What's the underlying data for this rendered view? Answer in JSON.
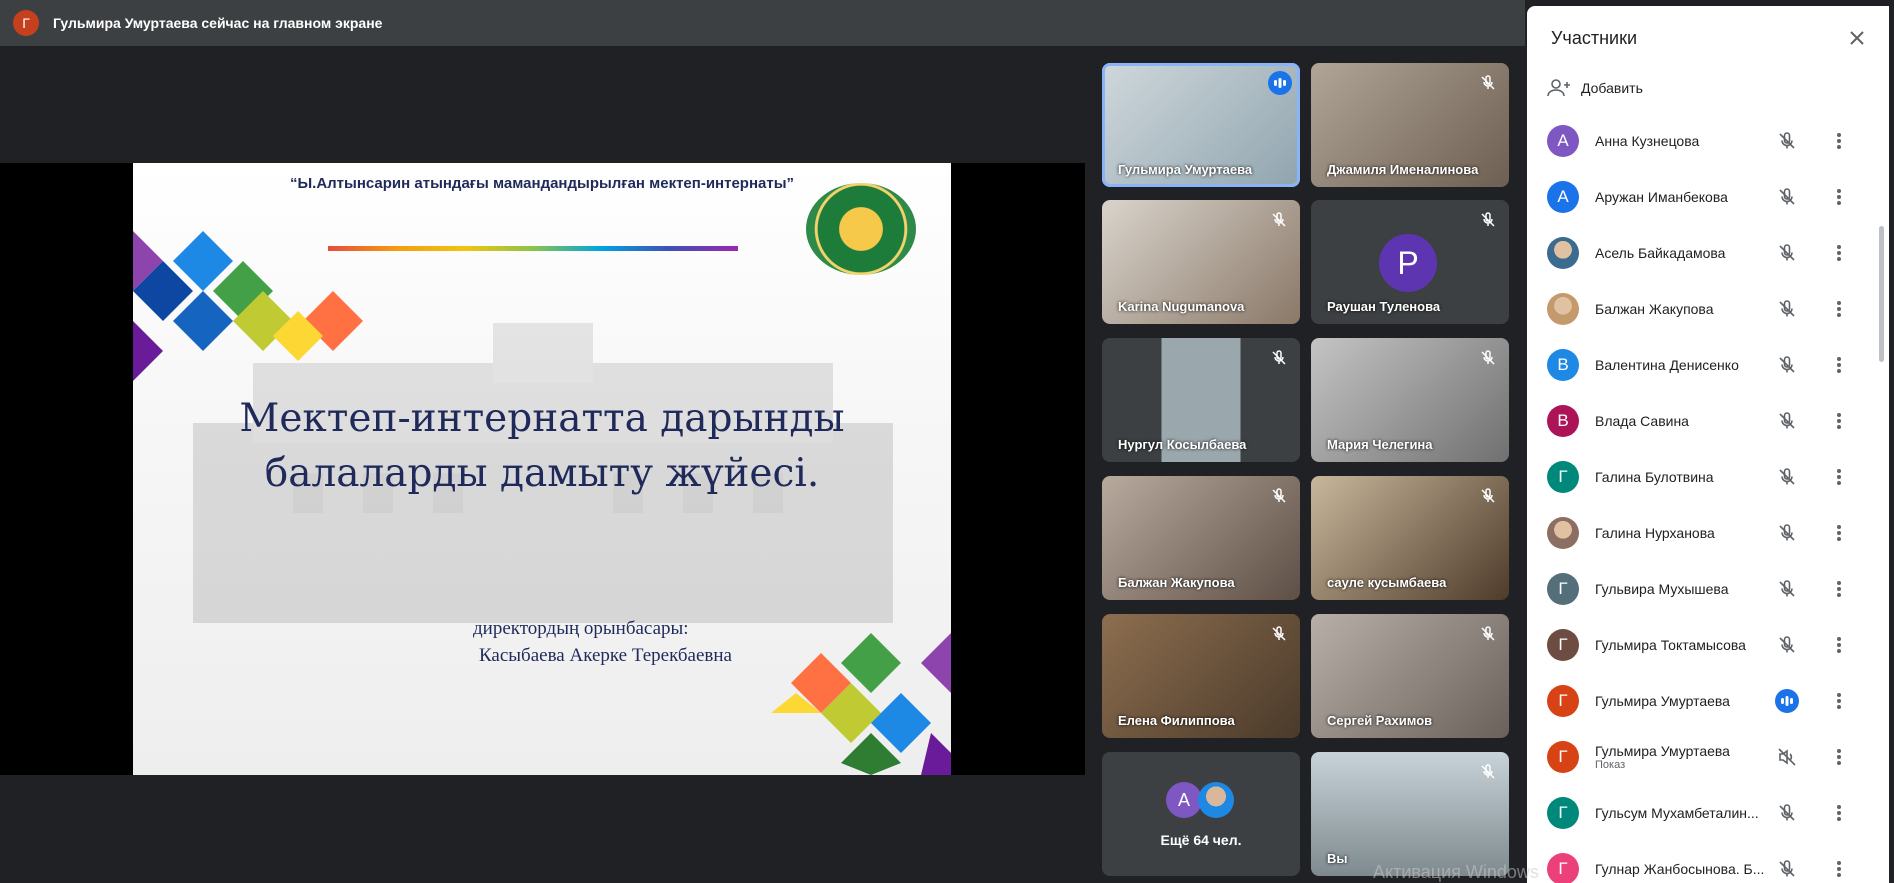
{
  "topbar": {
    "avatar_letter": "Г",
    "text": "Гульмира Умуртаева сейчас на главном экране"
  },
  "slide": {
    "header": "“Ы.Алтынсарин атындағы мамандандырылған мектеп-интернаты”",
    "title_line1": "Мектеп-интернатта дарынды",
    "title_line2": "балаларды дамыту жүйесі.",
    "sub_line1": "директордың  орынбасары:",
    "sub_line2": "Касыбаева Акерке Терекбаевна"
  },
  "tiles": [
    {
      "name": "Гульмира Умуртаева",
      "speaking": true
    },
    {
      "name": "Джамиля Именалинова"
    },
    {
      "name": "Karina Nugumanova"
    },
    {
      "name": "Раушан Туленова",
      "avatar_letter": "Р"
    },
    {
      "name": "Нургул Косылбаева"
    },
    {
      "name": "Мария Челегина"
    },
    {
      "name": "Балжан Жакупова"
    },
    {
      "name": "сауле кусымбаева"
    },
    {
      "name": "Елена Филиппова"
    },
    {
      "name": "Сергей Рахимов"
    },
    {
      "more_label": "Ещё 64 чел.",
      "avatar_letter": "А"
    },
    {
      "name": "Вы"
    }
  ],
  "panel": {
    "title": "Участники",
    "add_label": "Добавить",
    "people": [
      {
        "name": "Анна Кузнецова",
        "letter": "А",
        "color": "#7e57c2"
      },
      {
        "name": "Аружан Иманбекова",
        "letter": "А",
        "color": "#1a73e8"
      },
      {
        "name": "Асель Байкадамова",
        "letter": "",
        "color": "#3b6b8f"
      },
      {
        "name": "Балжан Жакупова",
        "letter": "",
        "color": "#c49a6c"
      },
      {
        "name": "Валентина Денисенко",
        "letter": "В",
        "color": "#1e88e5"
      },
      {
        "name": "Влада Савина",
        "letter": "В",
        "color": "#ad1457"
      },
      {
        "name": "Галина Булотвина",
        "letter": "Г",
        "color": "#00897b"
      },
      {
        "name": "Галина Нурханова",
        "letter": "",
        "color": "#8d6e63"
      },
      {
        "name": "Гульвира Мухышева",
        "letter": "Г",
        "color": "#546e7a"
      },
      {
        "name": "Гульмира Токтамысова",
        "letter": "Г",
        "color": "#6d4c41"
      },
      {
        "name": "Гульмира Умуртаева",
        "letter": "Г",
        "color": "#d84315",
        "speaking": true
      },
      {
        "name": "Гульмира Умуртаева",
        "letter": "Г",
        "color": "#d84315",
        "sub": "Показ",
        "muted_other": true
      },
      {
        "name": "Гульсум Мухамбеталин...",
        "letter": "Г",
        "color": "#00897b"
      },
      {
        "name": "Гулнар Жанбосынова. Б...",
        "letter": "Г",
        "color": "#ec407a"
      }
    ]
  },
  "watermark": "Активация Windows"
}
